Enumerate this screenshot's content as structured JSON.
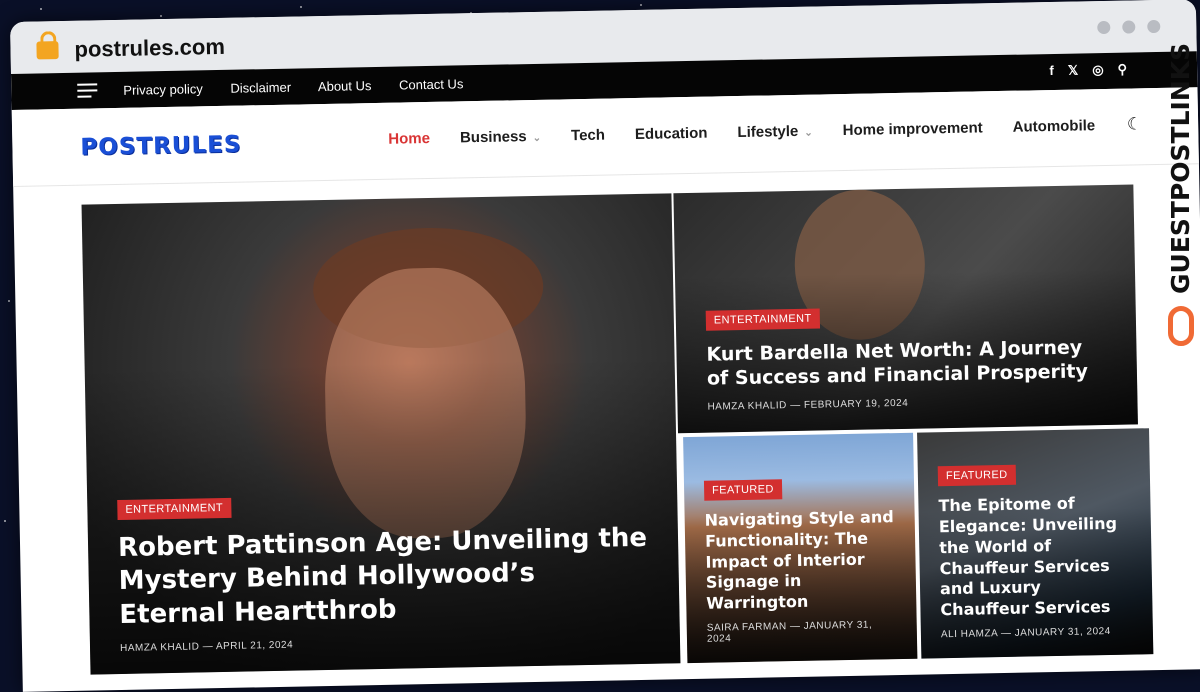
{
  "browser": {
    "url": "postrules.com"
  },
  "topbar": {
    "links": [
      "Privacy policy",
      "Disclaimer",
      "About Us",
      "Contact Us"
    ],
    "social": [
      "f",
      "𝕏",
      "◎"
    ]
  },
  "site": {
    "logo": "POSTRULES"
  },
  "nav": {
    "items": [
      "Home",
      "Business",
      "Tech",
      "Education",
      "Lifestyle",
      "Home improvement",
      "Automobile"
    ]
  },
  "articles": [
    {
      "category": "ENTERTAINMENT",
      "title": "Robert Pattinson Age: Unveiling the Mystery Behind Hollywood’s Eternal Heartthrob",
      "author": "HAMZA KHALID",
      "date": "APRIL 21, 2024"
    },
    {
      "category": "ENTERTAINMENT",
      "title": "Kurt Bardella Net Worth: A Journey of Success and Financial Prosperity",
      "author": "HAMZA KHALID",
      "date": "FEBRUARY 19, 2024"
    },
    {
      "category": "FEATURED",
      "title": "Navigating Style and Functionality: The Impact of Interior Signage in Warrington",
      "author": "SAIRA FARMAN",
      "date": "JANUARY 31, 2024"
    },
    {
      "category": "FEATURED",
      "title": "The Epitome of Elegance: Unveiling the World of Chauffeur Services and Luxury Chauffeur Services",
      "author": "ALI HAMZA",
      "date": "JANUARY 31, 2024"
    }
  ],
  "watermark": {
    "text": "GUESTPOSTLINKS"
  },
  "colors": {
    "accent": "#d93535",
    "badge": "#d32f2f",
    "logo": "#1a4fd6",
    "watermark_icon": "#f06a35"
  }
}
